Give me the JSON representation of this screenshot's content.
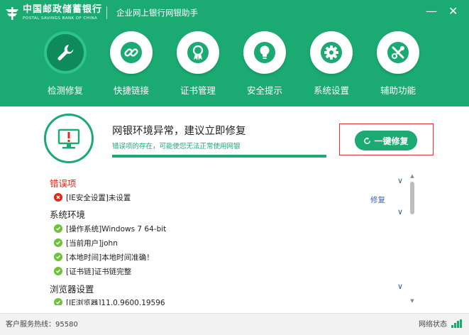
{
  "brand": {
    "name_cn": "中国邮政储蓄银行",
    "name_en": "POSTAL SAVINGS BANK OF CHINA"
  },
  "app": {
    "title": "企业网上银行网银助手"
  },
  "window": {
    "minimize": "—",
    "close": "✕"
  },
  "nav": {
    "items": [
      {
        "label": "检测修复",
        "icon": "wrench-icon",
        "active": true
      },
      {
        "label": "快捷链接",
        "icon": "link-icon"
      },
      {
        "label": "证书管理",
        "icon": "certificate-icon"
      },
      {
        "label": "安全提示",
        "icon": "lightbulb-icon"
      },
      {
        "label": "系统设置",
        "icon": "gear-icon"
      },
      {
        "label": "辅助功能",
        "icon": "tools-icon"
      }
    ]
  },
  "alert": {
    "title": "网银环境异常，建议立即修复",
    "subtitle": "错误项的存在，可能使您无法正常使用网银",
    "fix_button": "一键修复"
  },
  "sections": {
    "error": {
      "title": "错误项",
      "items": [
        {
          "text": "[IE安全设置]未设置",
          "action": "修复",
          "status": "error"
        }
      ]
    },
    "system": {
      "title": "系统环境",
      "items": [
        {
          "text": "[操作系统]Windows 7 64-bit",
          "status": "ok"
        },
        {
          "text": "[当前用户]john",
          "status": "ok"
        },
        {
          "text": "[本地时间]本地时间准确！",
          "status": "ok"
        },
        {
          "text": "[证书链]证书链完整",
          "status": "ok"
        }
      ]
    },
    "browser": {
      "title": "浏览器设置",
      "items": [
        {
          "text": "[IE浏览器]11.0.9600.19596",
          "status": "ok"
        }
      ]
    }
  },
  "footer": {
    "hotline": "客户服务热线：95580",
    "network_status": "网络状态"
  },
  "colors": {
    "brand_green": "#1aaa72",
    "error_red": "#e0281c",
    "ok_green": "#6cc23a",
    "link_blue": "#3a5fbf"
  }
}
